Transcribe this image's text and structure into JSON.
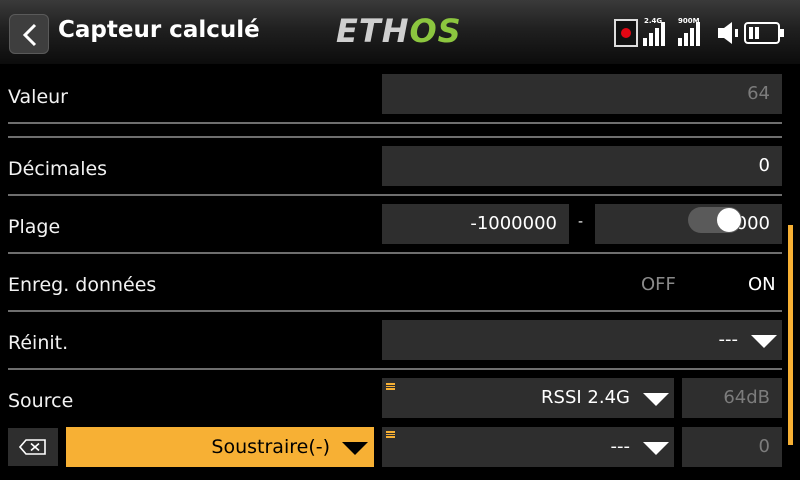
{
  "header": {
    "title": "Capteur calculé",
    "logo_part1": "ETH",
    "logo_part2": "OS",
    "sig1_label": "2.4G",
    "sig2_label": "900M",
    "accent": "#8cc63f"
  },
  "rows": {
    "valeur": {
      "label": "Valeur",
      "value": "64"
    },
    "decimales": {
      "label": "Décimales",
      "value": "0"
    },
    "plage": {
      "label": "Plage",
      "min": "-1000000",
      "sep": "-",
      "max": "1000000"
    },
    "enreg": {
      "label": "Enreg. données",
      "off": "OFF",
      "on": "ON",
      "state": "on"
    },
    "reinit": {
      "label": "Réinit.",
      "value": "---"
    },
    "source": {
      "label": "Source",
      "source_value": "RSSI 2.4G",
      "reading": "64dB"
    },
    "op": {
      "operation": "Soustraire(-)",
      "source_value": "---",
      "reading": "0"
    }
  },
  "colors": {
    "highlight": "#f7b034",
    "field_bg": "#2e2e2e",
    "rec": "#e30613"
  },
  "icons": [
    "back-arrow-icon",
    "record-icon",
    "signal-icon",
    "speaker-icon",
    "battery-icon",
    "delete-icon",
    "dropdown-arrow-icon",
    "drag-handle-icon"
  ]
}
